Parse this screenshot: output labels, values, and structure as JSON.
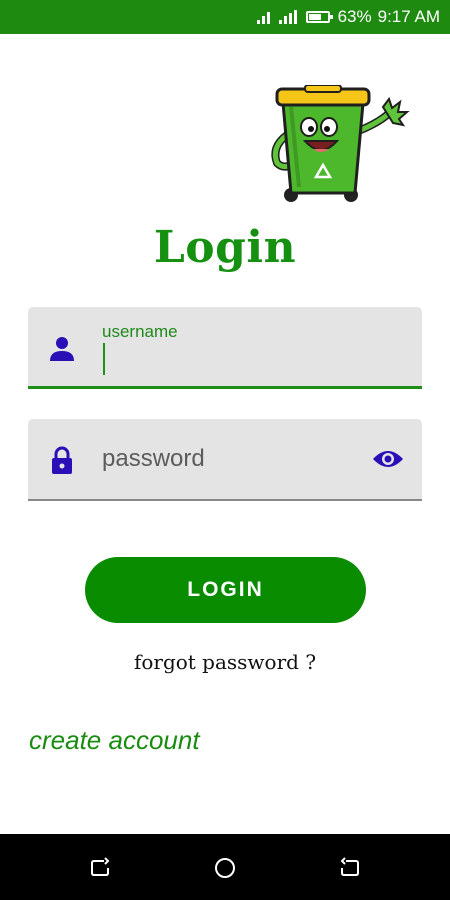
{
  "status_bar": {
    "battery": "63%",
    "time": "9:17 AM"
  },
  "title": "Login",
  "username_field": {
    "label": "username",
    "value": ""
  },
  "password_field": {
    "placeholder": "password",
    "value": ""
  },
  "login_button": {
    "label": "LOGIN"
  },
  "forgot_link": "forgot password ?",
  "create_link": "create account",
  "colors": {
    "brand_green": "#0a8c00",
    "status_bar": "#1e8a10",
    "icon_indigo": "#2a0fb6",
    "field_bg": "#e4e4e4"
  },
  "icons": [
    "signal-icon",
    "battery-icon",
    "person-icon",
    "lock-icon",
    "eye-icon",
    "recent-apps-icon",
    "home-icon",
    "back-icon"
  ]
}
